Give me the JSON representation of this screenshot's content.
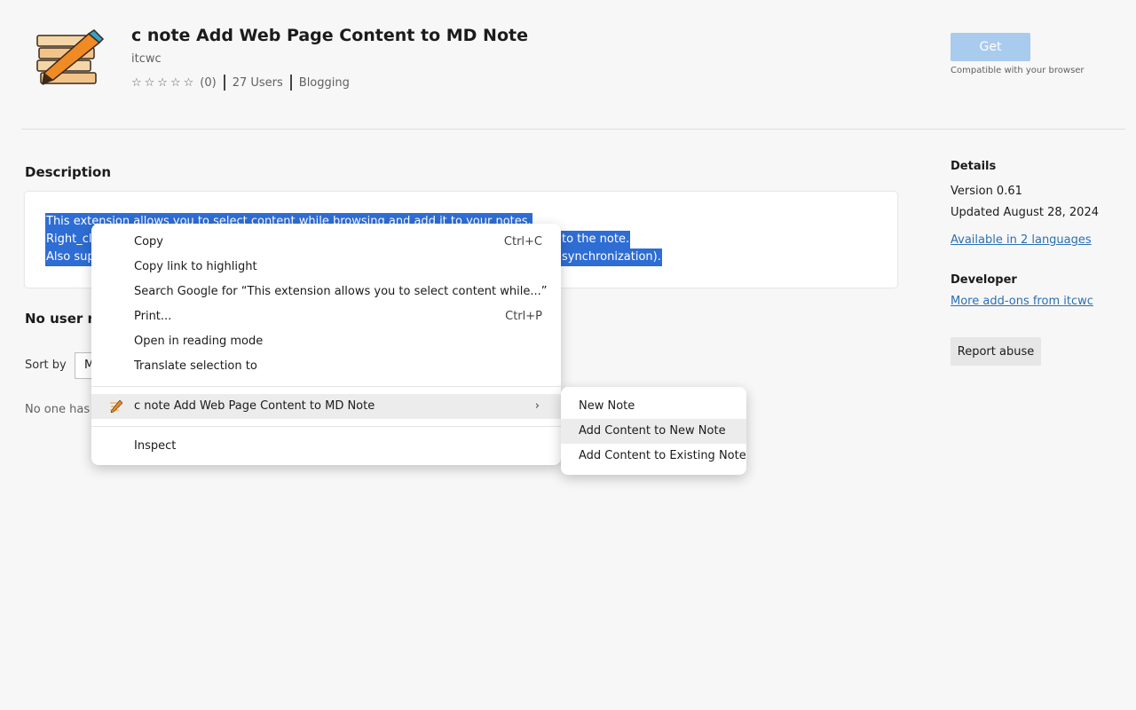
{
  "extension": {
    "title": "c note Add Web Page Content to MD Note",
    "publisher": "itcwc",
    "stars": "☆☆☆☆☆",
    "rating_count": "(0)",
    "users": "27 Users",
    "category": "Blogging",
    "get_label": "Get",
    "compat": "Compatible with your browser"
  },
  "description": {
    "heading": "Description",
    "line1": "This extension allows you to select content while browsing and add it to your notes.",
    "line2_start": "Right_cli",
    "line2_end": "to the note.",
    "line3_start": "Also sup",
    "line3_end": "synchronization)."
  },
  "reviews": {
    "heading": "No user re",
    "sort_label": "Sort by",
    "sort_value": "M",
    "empty": "No one has"
  },
  "details": {
    "heading": "Details",
    "version": "Version 0.61",
    "updated": "Updated August 28, 2024",
    "languages_link": "Available in 2 languages",
    "developer_heading": "Developer",
    "more_link": "More add-ons from itcwc",
    "report_label": "Report abuse"
  },
  "context_menu": {
    "copy": "Copy",
    "copy_sc": "Ctrl+C",
    "copy_link": "Copy link to highlight",
    "search": "Search Google for “This extension allows you to select content while...”",
    "print": "Print...",
    "print_sc": "Ctrl+P",
    "reading": "Open in reading mode",
    "translate": "Translate selection to",
    "extension_item": "c note Add Web Page Content to MD Note",
    "arrow": "›",
    "inspect": "Inspect"
  },
  "submenu": {
    "new_note": "New Note",
    "add_new": "Add Content to New Note",
    "add_existing": "Add Content to Existing Note"
  }
}
